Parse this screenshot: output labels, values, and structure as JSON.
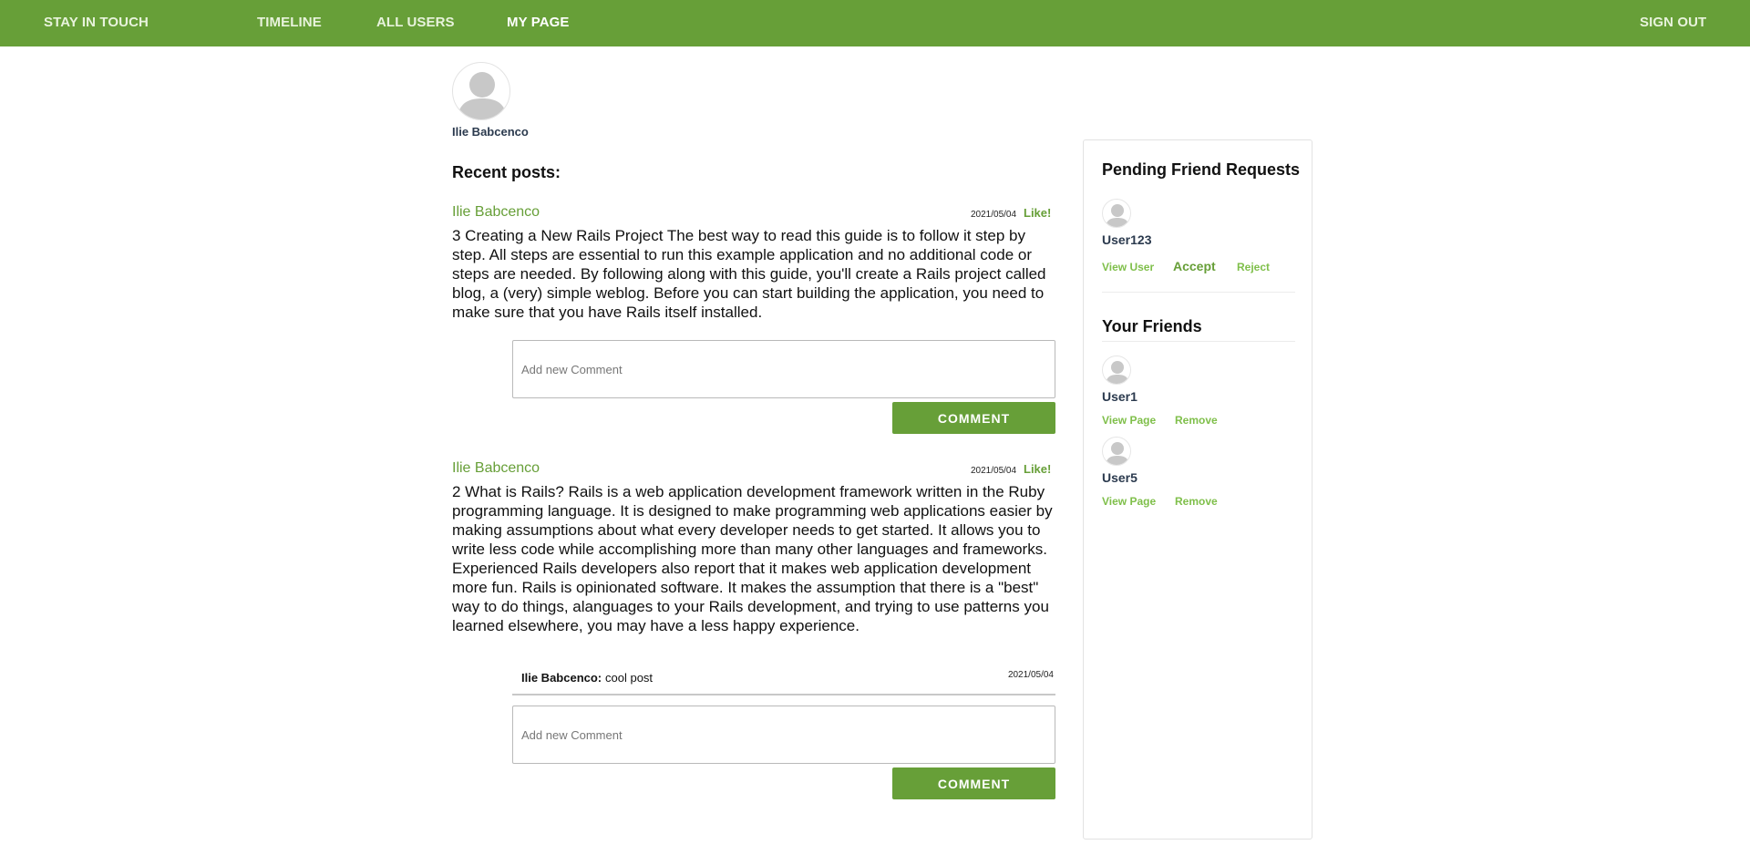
{
  "nav": {
    "brand": "STAY IN TOUCH",
    "timeline": "TIMELINE",
    "all_users": "ALL USERS",
    "my_page": "MY PAGE",
    "sign_out": "SIGN OUT"
  },
  "profile": {
    "name": "Ilie Babcenco"
  },
  "recent_posts_title": "Recent posts:",
  "posts": [
    {
      "author": "Ilie Babcenco",
      "date": "2021/05/04",
      "like_label": "Like!",
      "body": "3 Creating a New Rails Project The best way to read this guide is to follow it step by step. All steps are essential to run this example application and no additional code or steps are needed. By following along with this guide, you'll create a Rails project called blog, a (very) simple weblog. Before you can start building the application, you need to make sure that you have Rails itself installed.",
      "comment_placeholder": "Add new Comment",
      "comment_button": "COMMENT"
    },
    {
      "author": "Ilie Babcenco",
      "date": "2021/05/04",
      "like_label": "Like!",
      "body": "2 What is Rails? Rails is a web application development framework written in the Ruby programming language. It is designed to make programming web applications easier by making assumptions about what every developer needs to get started. It allows you to write less code while accomplishing more than many other languages and frameworks. Experienced Rails developers also report that it makes web application development more fun. Rails is opinionated software. It makes the assumption that there is a \"best\" way to do things, alanguages to your Rails development, and trying to use patterns you learned elsewhere, you may have a less happy experience.",
      "comments": [
        {
          "author": "Ilie Babcenco:",
          "text": "cool post",
          "date": "2021/05/04"
        }
      ],
      "comment_placeholder": "Add new Comment",
      "comment_button": "COMMENT"
    }
  ],
  "sidebar": {
    "pending_title": "Pending Friend Requests",
    "pending": [
      {
        "name": "User123",
        "view_label": "View User",
        "accept_label": "Accept",
        "reject_label": "Reject"
      }
    ],
    "friends_title": "Your Friends",
    "friends": [
      {
        "name": "User1",
        "view_label": "View Page",
        "remove_label": "Remove"
      },
      {
        "name": "User5",
        "view_label": "View Page",
        "remove_label": "Remove"
      }
    ]
  },
  "colors": {
    "brand_green": "#679f38",
    "link_green": "#7fbf4a",
    "avatar_gray": "#c8c8c8"
  },
  "icons": {
    "avatar": "user-silhouette-icon"
  }
}
